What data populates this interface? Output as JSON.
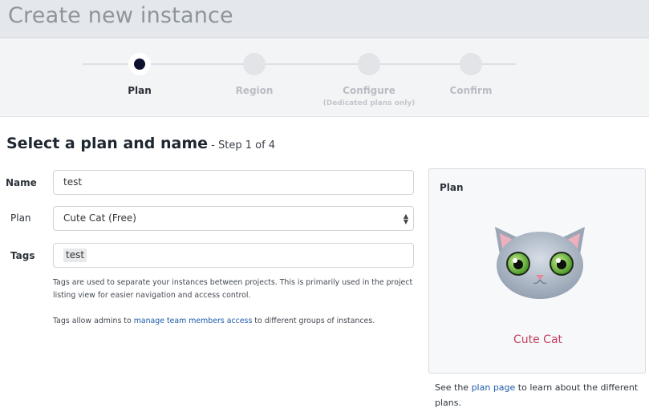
{
  "page": {
    "title": "Create new instance"
  },
  "steps": [
    {
      "label": "Plan",
      "sublabel": "",
      "active": true
    },
    {
      "label": "Region",
      "sublabel": "",
      "active": false
    },
    {
      "label": "Configure",
      "sublabel": "(Dedicated plans only)",
      "active": false
    },
    {
      "label": "Confirm",
      "sublabel": "",
      "active": false
    }
  ],
  "section": {
    "title": "Select a plan and name",
    "step_count": " - Step 1 of 4"
  },
  "form": {
    "name_label": "Name",
    "name_value": "test",
    "plan_label": "Plan",
    "plan_selected": "Cute Cat (Free)",
    "tags_label": "Tags",
    "tags": [
      "test"
    ],
    "help_text_1": "Tags are used to separate your instances between projects. This is primarily used in the project listing view for easier navigation and access control.",
    "help_text_2_prefix": "Tags allow admins to ",
    "help_text_2_link": "manage team members access",
    "help_text_2_suffix": " to different groups of instances."
  },
  "plan_card": {
    "title": "Plan",
    "plan_name": "Cute Cat",
    "avatar_icon": "cute-cat-icon"
  },
  "footer": {
    "prefix": "See the ",
    "link": "plan page",
    "suffix": " to learn about the different plans."
  },
  "colors": {
    "header_bg": "#e4e7ec",
    "active_step": "#0e1230",
    "link": "#1f5aa8",
    "plan_name": "#c3405d"
  }
}
